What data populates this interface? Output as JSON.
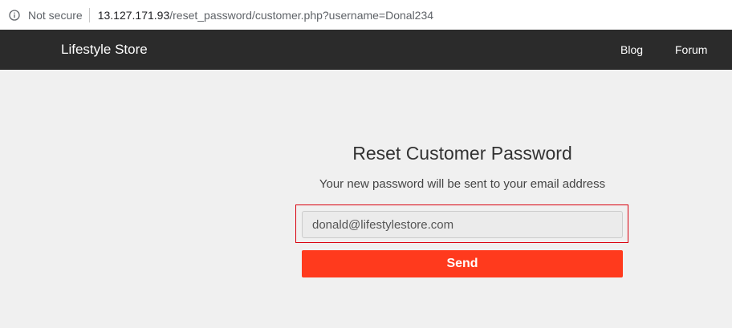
{
  "browser": {
    "security_label": "Not secure",
    "url_host": "13.127.171.93",
    "url_path": "/reset_password/customer.php?username=Donal234",
    "icons": {
      "security": "info-circle-icon"
    }
  },
  "navbar": {
    "brand": "Lifestyle Store",
    "links": [
      {
        "label": "Blog"
      },
      {
        "label": "Forum"
      }
    ],
    "background_color": "#2b2b2b"
  },
  "reset_form": {
    "title": "Reset Customer Password",
    "subtitle": "Your new password will be sent to your email address",
    "email_value": "donald@lifestylestore.com",
    "send_label": "Send",
    "accent_color": "#ff3a1d",
    "highlight_color": "#d9000d"
  }
}
